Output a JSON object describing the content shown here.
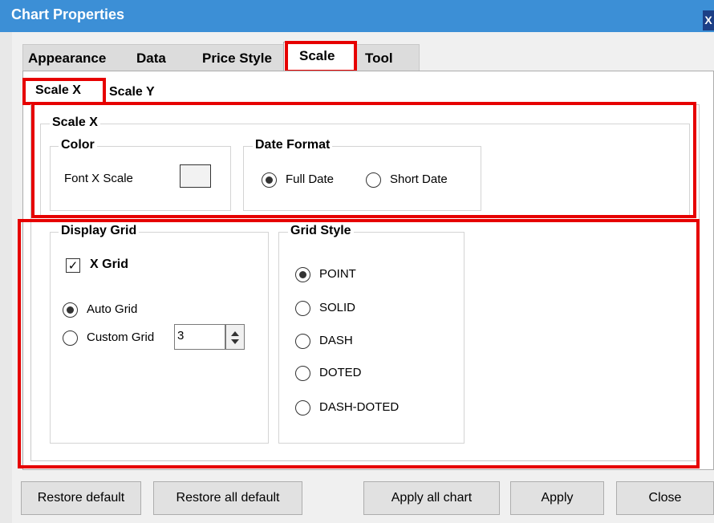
{
  "window": {
    "title": "Chart Properties",
    "close_glyph": "X"
  },
  "tabs": [
    {
      "label": "Appearance",
      "active": false
    },
    {
      "label": "Data",
      "active": false
    },
    {
      "label": "Price Style",
      "active": false
    },
    {
      "label": "Scale",
      "active": true
    },
    {
      "label": "Tool",
      "active": false
    }
  ],
  "subtabs": [
    {
      "label": "Scale X",
      "active": true
    },
    {
      "label": "Scale Y",
      "active": false
    }
  ],
  "scale_x": {
    "legend": "Scale X",
    "color_group": {
      "legend": "Color",
      "font_label": "Font X Scale",
      "swatch_color": "#f2f2f2"
    },
    "date_format_group": {
      "legend": "Date Format",
      "options": [
        {
          "label": "Full Date",
          "selected": true
        },
        {
          "label": "Short Date",
          "selected": false
        }
      ]
    }
  },
  "display_grid": {
    "legend": "Display Grid",
    "x_grid": {
      "label": "X Grid",
      "checked": true,
      "check_glyph": "✓"
    },
    "options": [
      {
        "label": "Auto Grid",
        "selected": true
      },
      {
        "label": "Custom Grid",
        "selected": false
      }
    ],
    "custom_value": "3"
  },
  "grid_style": {
    "legend": "Grid Style",
    "options": [
      {
        "label": "POINT",
        "selected": true
      },
      {
        "label": "SOLID",
        "selected": false
      },
      {
        "label": "DASH",
        "selected": false
      },
      {
        "label": "DOTED",
        "selected": false
      },
      {
        "label": "DASH-DOTED",
        "selected": false
      }
    ]
  },
  "buttons": {
    "restore_default": "Restore default",
    "restore_all_default": "Restore all default",
    "apply_all_chart": "Apply all chart",
    "apply": "Apply",
    "close": "Close"
  },
  "colors": {
    "titlebar": "#3c8fd6",
    "highlight": "#e60000"
  }
}
